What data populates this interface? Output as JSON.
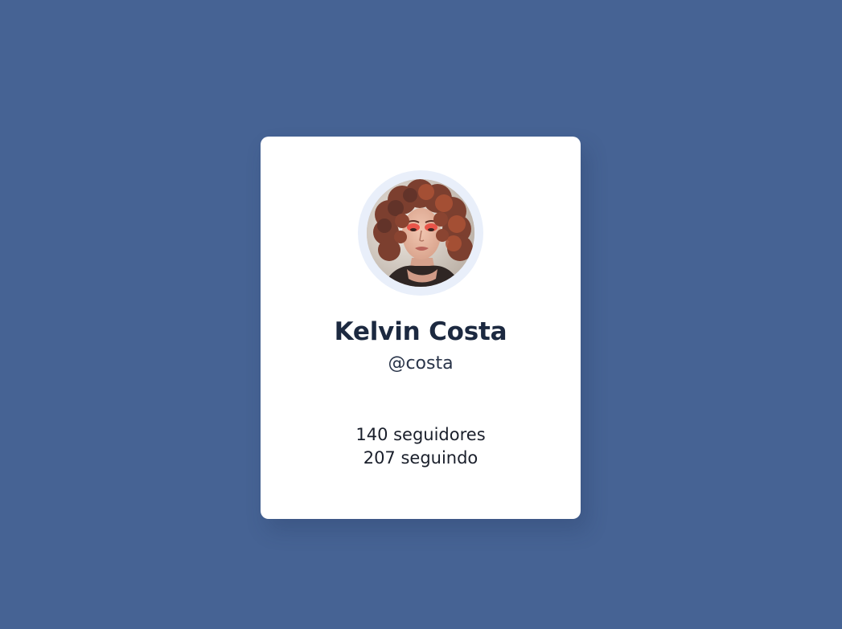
{
  "profile": {
    "name": "Kelvin Costa",
    "handle": "@costa",
    "followers": "140 seguidores",
    "following": "207 seguindo",
    "avatar_icon": "avatar-photo"
  },
  "colors": {
    "background": "#466394",
    "card": "#ffffff",
    "avatar_ring": "#e9effa",
    "name_text": "#1c2940"
  }
}
